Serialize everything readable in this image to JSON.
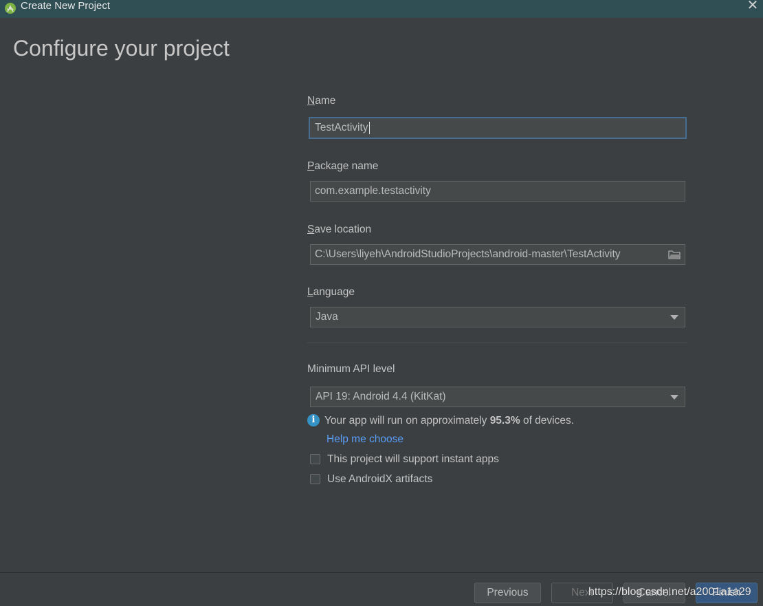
{
  "window": {
    "title": "Create New Project",
    "close_glyph": "✕"
  },
  "heading": "Configure your project",
  "form": {
    "name": {
      "label_mnemonic": "N",
      "label_rest": "ame",
      "value": "TestActivity"
    },
    "package": {
      "label_mnemonic": "P",
      "label_rest": "ackage name",
      "value": "com.example.testactivity"
    },
    "save_location": {
      "label_mnemonic": "S",
      "label_rest": "ave location",
      "value": "C:\\Users\\liyeh\\AndroidStudioProjects\\android-master\\TestActivity"
    },
    "language": {
      "label_mnemonic": "L",
      "label_rest": "anguage",
      "value": "Java"
    },
    "min_api": {
      "label": "Minimum API level",
      "value": "API 19: Android 4.4 (KitKat)"
    },
    "info": {
      "icon": "i",
      "prefix": "Your app will run on approximately ",
      "percent": "95.3%",
      "suffix": " of devices."
    },
    "help_link": "Help me choose",
    "instant_apps": {
      "label": "This project will support instant apps",
      "checked": false
    },
    "androidx": {
      "label": "Use AndroidX artifacts",
      "checked": false
    }
  },
  "buttons": {
    "previous": "Previous",
    "next": "Next",
    "cancel": "Cancel",
    "finish": "Finish"
  },
  "watermark": "https://blog.csdn.net/a2001a1a29",
  "colors": {
    "background": "#3c3f41",
    "titlebar": "#2f4f55",
    "focus_border": "#466d94",
    "link": "#589df6",
    "info_icon": "#3592c4",
    "primary_button": "#365880"
  }
}
